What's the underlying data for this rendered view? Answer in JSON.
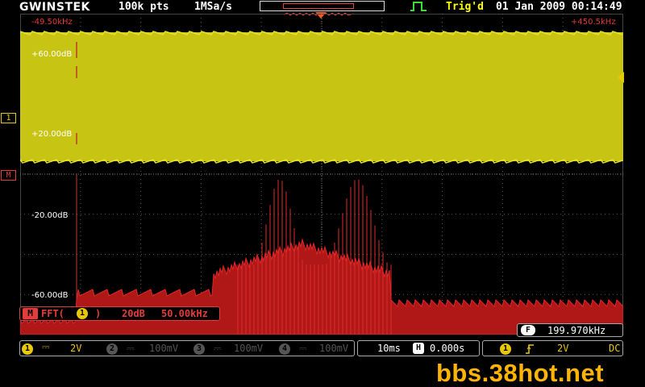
{
  "header": {
    "brand": "GWINSTEK",
    "record_length": "100k pts",
    "sample_rate": "1MSa/s",
    "trigger_status": "Trig'd",
    "datetime": "01 Jan 2009 00:14:49"
  },
  "screen": {
    "freq_start": "-49.50kHz",
    "freq_end": "+450.5kHz",
    "ch1_ticks": [
      "+60.00dB",
      "+20.00dB"
    ],
    "math_ticks": [
      "-20.00dB",
      "-60.00dB"
    ],
    "ch1_marker": "1",
    "math_marker": "M"
  },
  "math": {
    "tag": "M",
    "func": "FFT(",
    "channel": "1",
    "close": ")",
    "scale": "20dB",
    "span": "50.00kHz"
  },
  "freq_counter": {
    "tag": "F",
    "value": "199.970kHz"
  },
  "channels": [
    {
      "num": "1",
      "coupling": "DC",
      "scale": "2V",
      "active": true
    },
    {
      "num": "2",
      "scale": "100mV",
      "active": false
    },
    {
      "num": "3",
      "scale": "100mV",
      "active": false
    },
    {
      "num": "4",
      "scale": "100mV",
      "active": false
    }
  ],
  "timebase": {
    "scale": "10ms",
    "pos_tag": "H",
    "position": "0.000s"
  },
  "trigger": {
    "source": "1",
    "slope": "rising",
    "level": "2V",
    "coupling": "DC"
  },
  "watermark": "bbs.38hot.net",
  "colors": {
    "ch1": "#c8c414",
    "math": "#e43b3b",
    "grid": "#5a5a5a"
  }
}
